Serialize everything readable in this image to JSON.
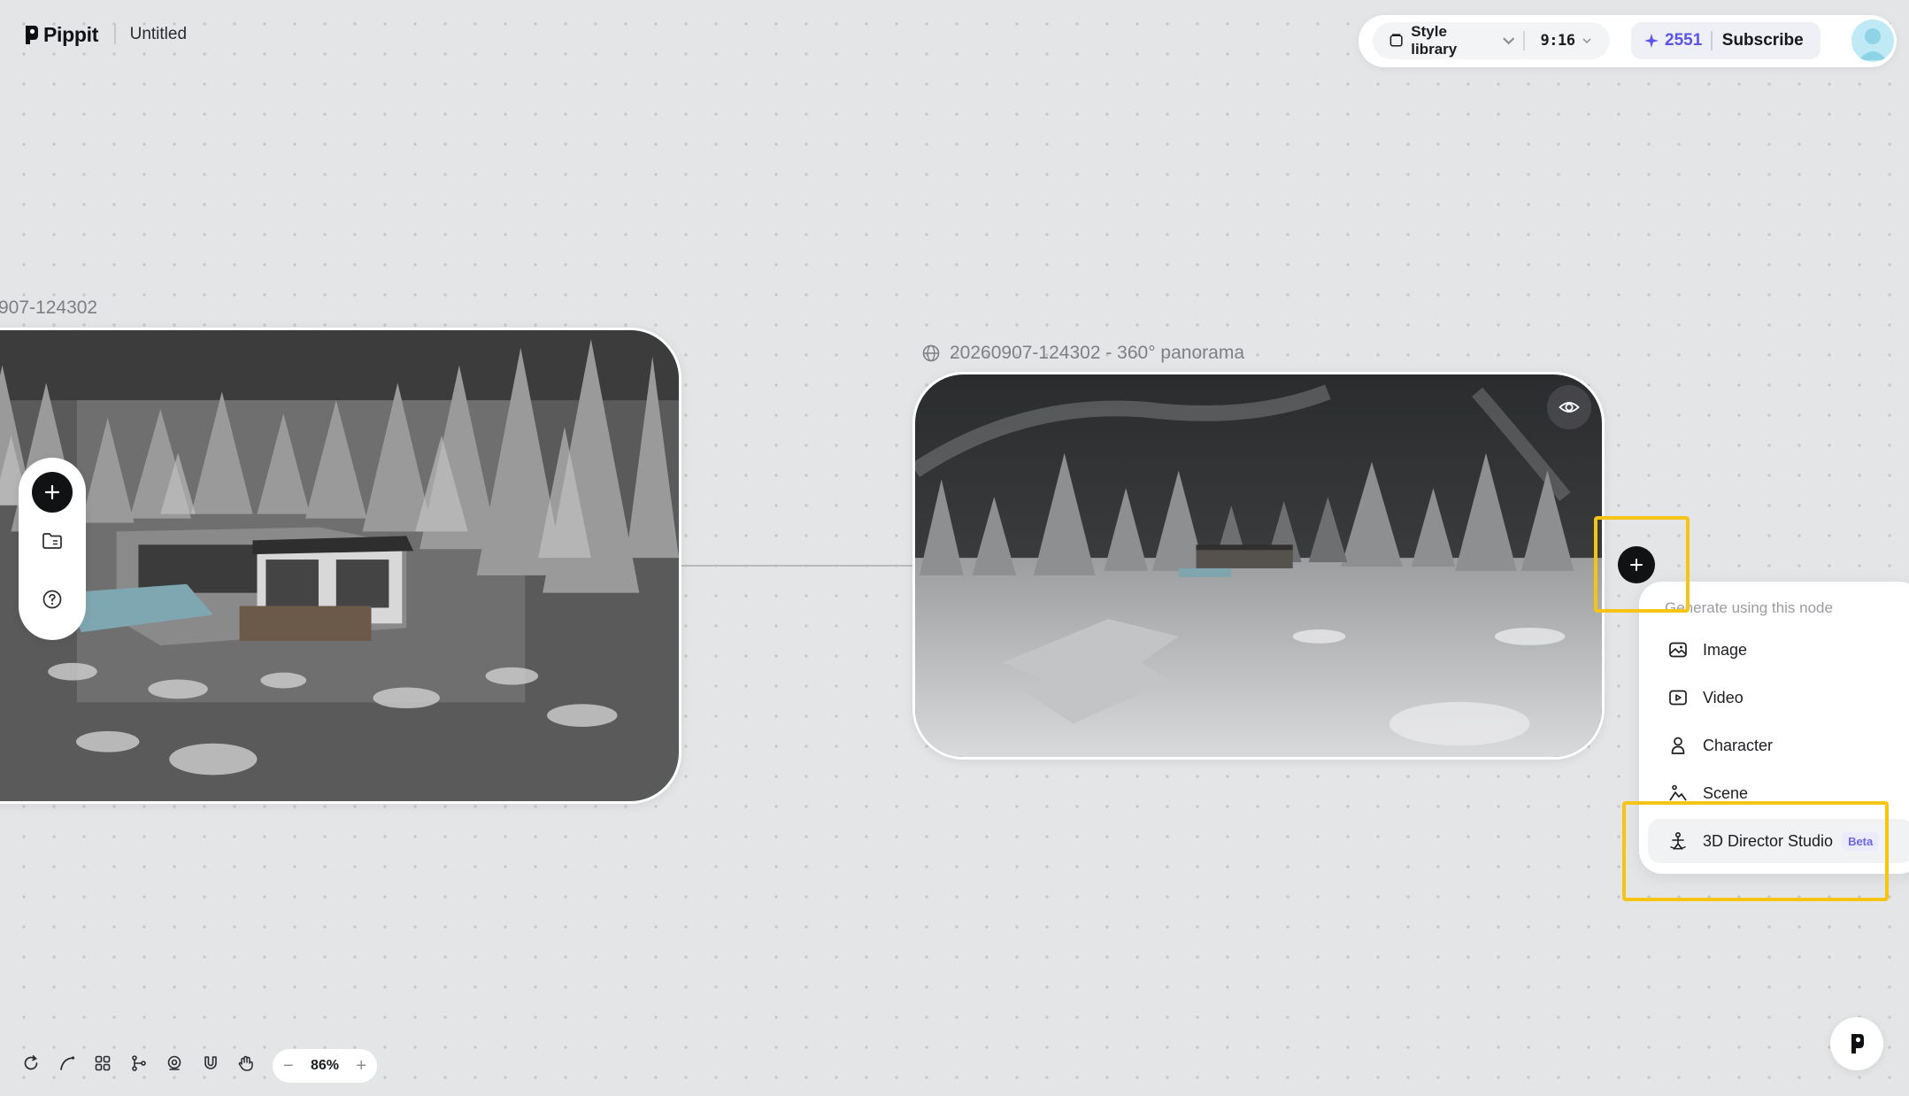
{
  "app": {
    "brand": "Pippit",
    "document_title": "Untitled"
  },
  "topbar": {
    "style_library_label": "Style library",
    "aspect_ratio": "9:16",
    "credits": "2551",
    "subscribe_label": "Subscribe"
  },
  "nodes": [
    {
      "label": "907-124302"
    },
    {
      "label": "20260907-124302 - 360° panorama"
    }
  ],
  "context_menu": {
    "heading": "Generate using this node",
    "items": [
      {
        "label": "Image",
        "icon": "image-icon"
      },
      {
        "label": "Video",
        "icon": "video-icon"
      },
      {
        "label": "Character",
        "icon": "character-icon"
      },
      {
        "label": "Scene",
        "icon": "scene-icon"
      },
      {
        "label": "3D Director Studio",
        "icon": "director-studio-icon",
        "badge": "Beta"
      }
    ]
  },
  "canvas": {
    "zoom_level": "86%",
    "zoom_out": "−",
    "zoom_in": "+"
  },
  "colors": {
    "accent": "#5b54e6",
    "highlight": "#f6c415",
    "canvas_bg": "#e4e5e7"
  }
}
